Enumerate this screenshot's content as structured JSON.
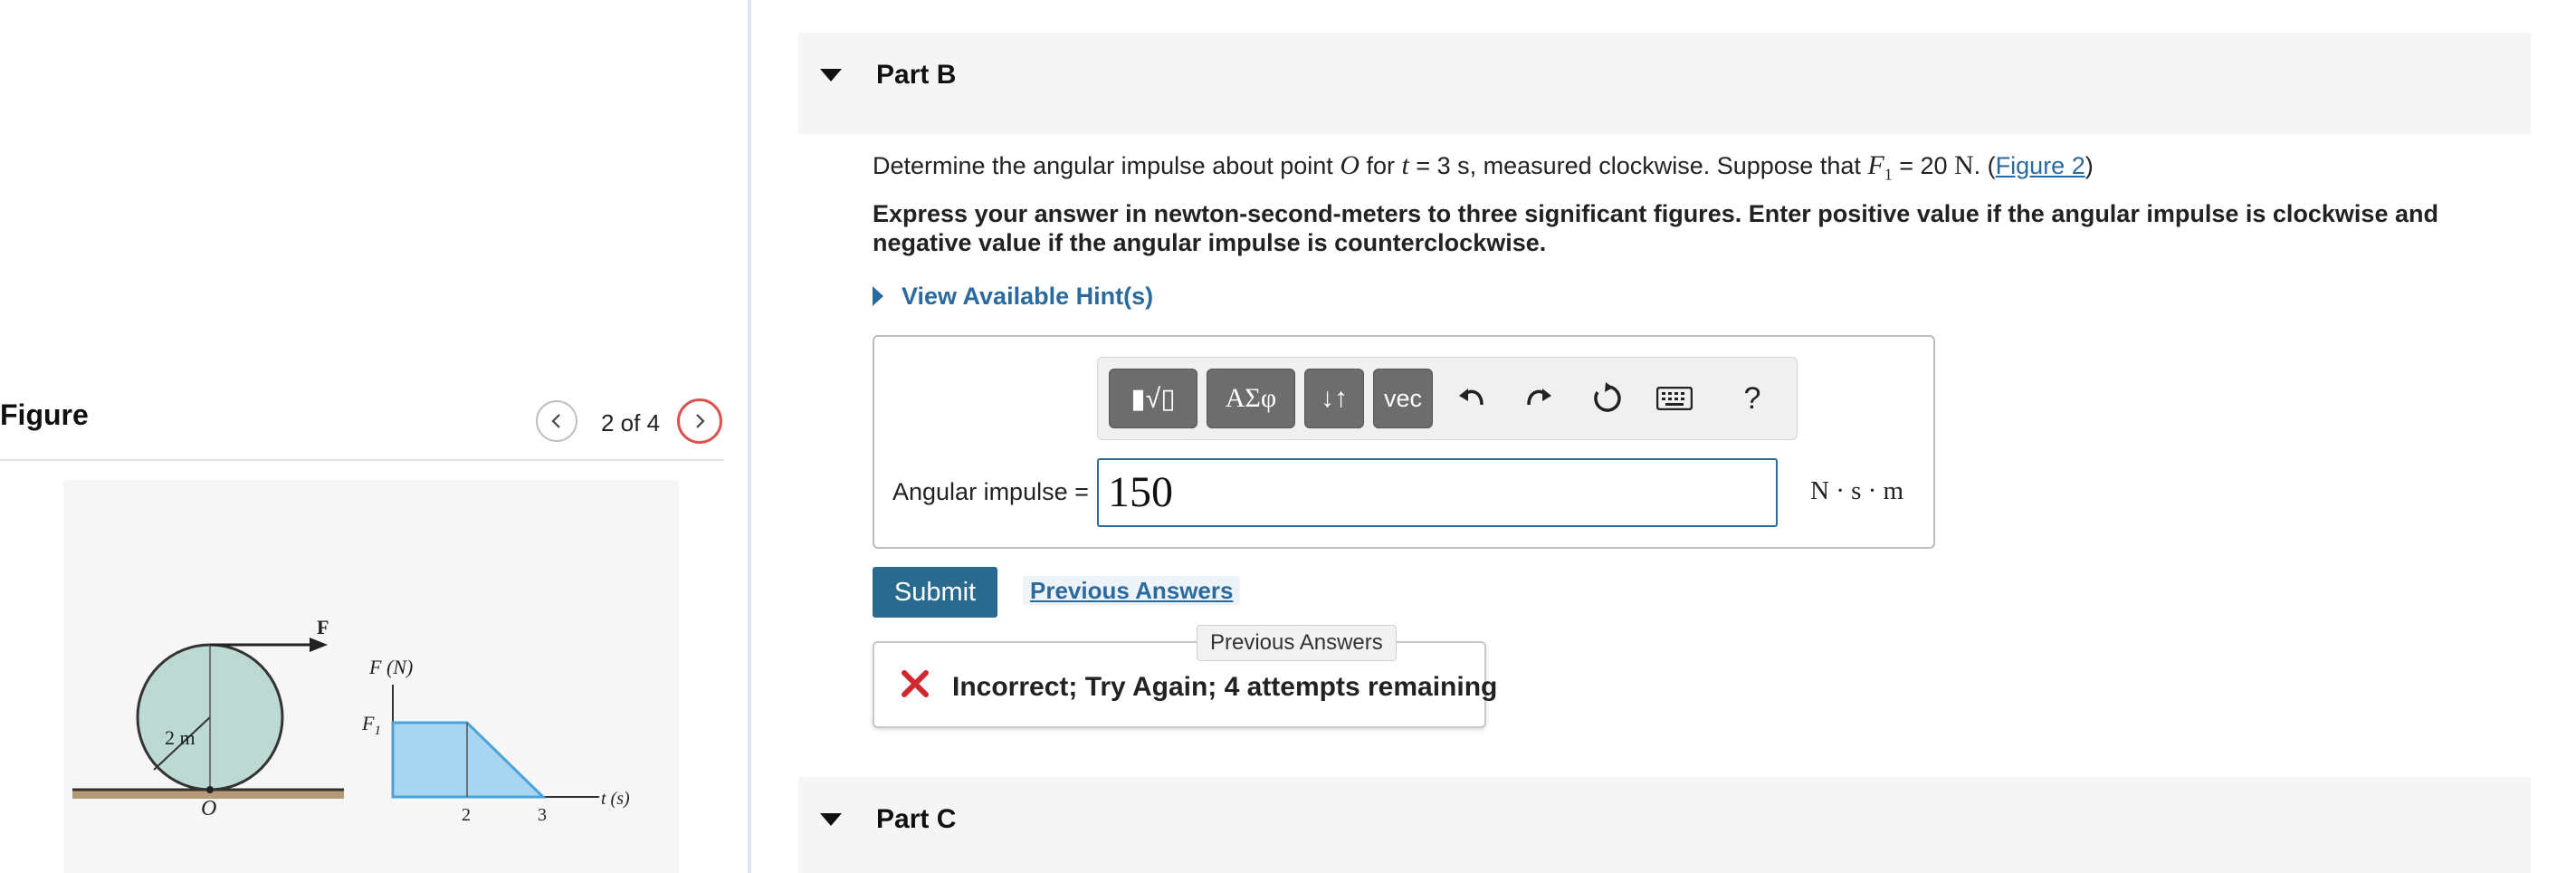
{
  "figure_panel": {
    "title": "Figure",
    "page_counter": "2 of 4",
    "prev_icon": "chevron-left-icon",
    "next_icon": "chevron-right-icon",
    "diagram": {
      "force_label": "F",
      "radius_label": "2 m",
      "point_label": "O",
      "yaxis_label": "F (N)",
      "f1_label": "F",
      "f1_sub": "1",
      "xaxis_label": "t (s)",
      "tick_2": "2",
      "tick_3": "3"
    }
  },
  "part_b": {
    "title": "Part B",
    "question": {
      "t1": "Determine the angular impulse about point ",
      "point": "O",
      "t2": " for ",
      "tvar": "t",
      "t3": " = 3 s, measured clockwise. Suppose that ",
      "fvar": "F",
      "fsub": "1",
      "t4": " = 20 ",
      "unitN": "N",
      "t5": ". (",
      "link": "Figure 2",
      "t6": ")"
    },
    "instructions": "Express your answer in newton-second-meters to three significant figures. Enter positive value if the angular impulse is clockwise and negative value if the angular impulse is counterclockwise.",
    "hint_label": "View Available Hint(s)",
    "toolbar": {
      "templates_label": "▮√▯",
      "greek_label": "ΑΣφ",
      "arrows_label": "↓↑",
      "vec_label": "vec",
      "undo_icon": "undo-icon",
      "redo_icon": "redo-icon",
      "reset_icon": "reset-icon",
      "keyboard_icon": "keyboard-icon",
      "help_label": "?"
    },
    "answer_label": "Angular impulse =",
    "answer_value": "150",
    "answer_unit": "N · s · m",
    "submit_label": "Submit",
    "previous_answers_label": "Previous Answers",
    "tooltip": "Previous Answers",
    "feedback": "Incorrect; Try Again; 4 attempts remaining"
  },
  "part_c": {
    "title": "Part C"
  },
  "colors": {
    "link": "#2a6a9e",
    "submit": "#2a6a8f",
    "error": "#d0282e",
    "next_ring": "#d9534f"
  }
}
